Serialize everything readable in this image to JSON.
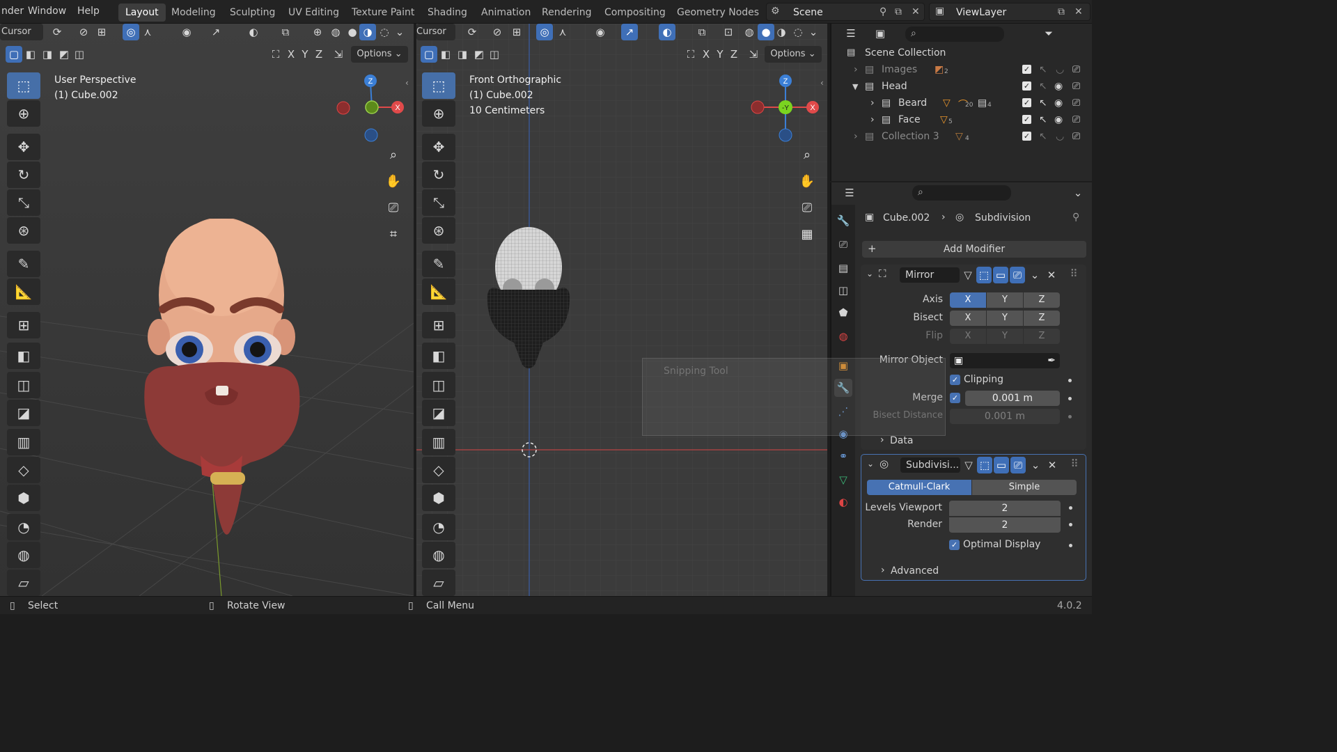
{
  "menu": {
    "items": [
      "nder",
      "Window",
      "Help"
    ],
    "workspaces": [
      "Layout",
      "Modeling",
      "Sculpting",
      "UV Editing",
      "Texture Paint",
      "Shading",
      "Animation",
      "Rendering",
      "Compositing",
      "Geometry Nodes"
    ],
    "active_workspace": "Layout",
    "scene": "Scene",
    "view_layer": "ViewLayer"
  },
  "viewport_left": {
    "mode_label": "Cursor",
    "view_name": "User Perspective",
    "object_name": "(1) Cube.002",
    "axes": [
      "X",
      "Y",
      "Z"
    ],
    "options_label": "Options",
    "gizmo": {
      "z": "Z",
      "x": "X"
    }
  },
  "viewport_right": {
    "mode_label": "Cursor",
    "view_name": "Front Orthographic",
    "object_name": "(1) Cube.002",
    "scale_label": "10 Centimeters",
    "axes": [
      "X",
      "Y",
      "Z"
    ],
    "options_label": "Options",
    "gizmo": {
      "z": "Z",
      "y": "-Y",
      "x": "X"
    }
  },
  "snipping_tool": "Snipping Tool",
  "outliner": {
    "root": "Scene Collection",
    "rows": [
      {
        "label": "Images",
        "badge": "2"
      },
      {
        "label": "Head",
        "badge": ""
      },
      {
        "label": "Beard",
        "badge": "20",
        "badge2": "4"
      },
      {
        "label": "Face",
        "badge": "5"
      },
      {
        "label": "Collection 3",
        "badge": "4"
      }
    ]
  },
  "properties": {
    "breadcrumb_object": "Cube.002",
    "breadcrumb_modifier": "Subdivision",
    "add_modifier": "Add Modifier",
    "mirror": {
      "name": "Mirror",
      "axis_label": "Axis",
      "bisect_label": "Bisect",
      "flip_label": "Flip",
      "axes": [
        "X",
        "Y",
        "Z"
      ],
      "mirror_object_label": "Mirror Object",
      "clipping_label": "Clipping",
      "merge_label": "Merge",
      "merge_value": "0.001 m",
      "bisect_distance_label": "Bisect Distance",
      "bisect_distance_value": "0.001 m",
      "data_label": "Data"
    },
    "subdivision": {
      "name": "Subdivisi...",
      "catmull": "Catmull-Clark",
      "simple": "Simple",
      "levels_viewport_label": "Levels Viewport",
      "levels_viewport_value": "2",
      "render_label": "Render",
      "render_value": "2",
      "optimal_display_label": "Optimal Display",
      "advanced_label": "Advanced"
    }
  },
  "statusbar": {
    "select": "Select",
    "rotate": "Rotate View",
    "call_menu": "Call Menu",
    "version": "4.0.2"
  },
  "colors": {
    "accent_blue": "#4772b3",
    "axis_x": "#e04a4a",
    "axis_y": "#7ad420",
    "axis_z": "#3b7fd6"
  }
}
